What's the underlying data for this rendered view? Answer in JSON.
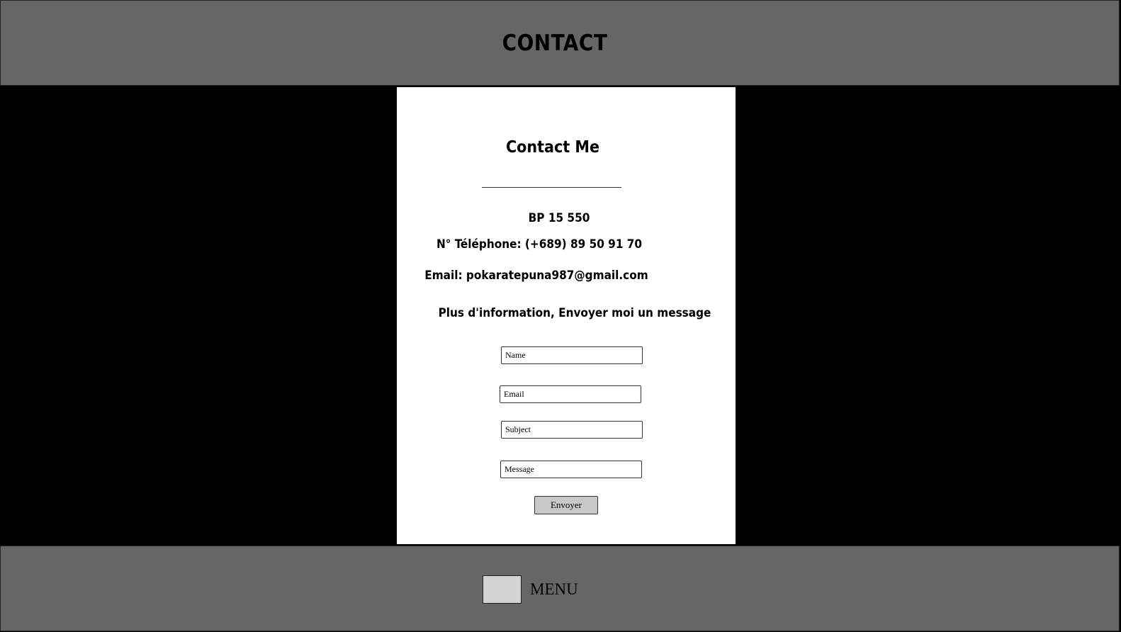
{
  "header": {
    "title": "CONTACT"
  },
  "card": {
    "title": "Contact Me",
    "address": "BP 15 550",
    "phone": "N° Téléphone:  (+689) 89 50 91 70",
    "email": "Email: pokaratepuna987@gmail.com",
    "prompt": "Plus d'information, Envoyer moi un message"
  },
  "form": {
    "name_placeholder": "Name",
    "email_placeholder": "Email",
    "subject_placeholder": "Subject",
    "message_placeholder": "Message",
    "submit_label": "Envoyer"
  },
  "footer": {
    "menu_label": "MENU"
  },
  "colors": {
    "header_bg": "#666666",
    "page_bg": "#000000",
    "card_bg": "#ffffff",
    "button_bg": "#c8c8c8"
  }
}
